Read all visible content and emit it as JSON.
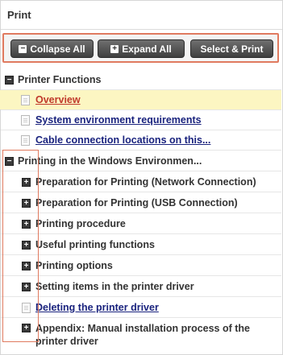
{
  "panel": {
    "title": "Print"
  },
  "toolbar": {
    "collapse_all": "Collapse All",
    "expand_all": "Expand All",
    "select_print": "Select & Print"
  },
  "tree": {
    "group1": {
      "label": "Printer Functions",
      "items": [
        {
          "label": "Overview"
        },
        {
          "label": "System environment requirements"
        },
        {
          "label": "Cable connection locations on this..."
        }
      ]
    },
    "group2": {
      "label": "Printing in the Windows Environmen...",
      "items": [
        {
          "label": "Preparation for Printing (Network Connection)"
        },
        {
          "label": "Preparation for Printing (USB Connection)"
        },
        {
          "label": "Printing procedure"
        },
        {
          "label": "Useful printing functions"
        },
        {
          "label": "Printing options"
        },
        {
          "label": "Setting items in the printer driver"
        },
        {
          "label": "Deleting the printer driver"
        },
        {
          "label": "Appendix: Manual installation process of the",
          "label2": "printer driver"
        }
      ]
    }
  },
  "colors": {
    "accent_outline": "#e07a5f",
    "active_link": "#c0392b",
    "link": "#1a237e",
    "highlight": "#fcf6c2"
  }
}
